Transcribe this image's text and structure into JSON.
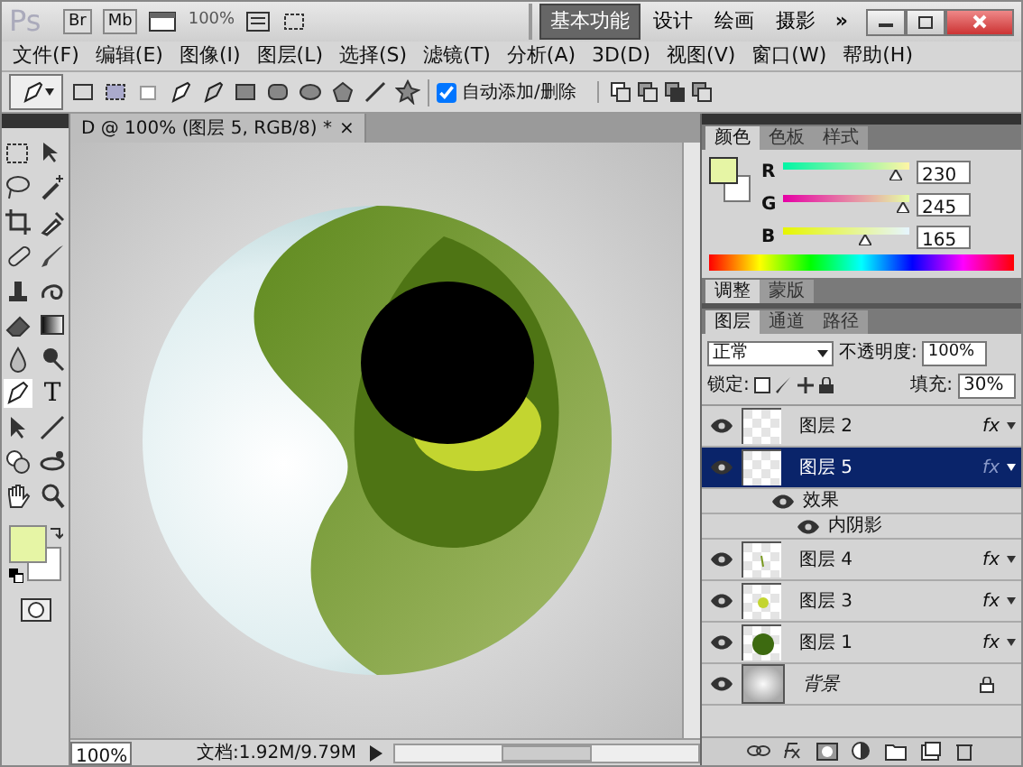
{
  "app_bar": {
    "logo": "Ps",
    "buttons": [
      "Br",
      "Mb"
    ],
    "zoom": "100%",
    "workspaces": [
      {
        "label": "基本功能",
        "selected": true
      },
      {
        "label": "设计",
        "selected": false
      },
      {
        "label": "绘画",
        "selected": false
      },
      {
        "label": "摄影",
        "selected": false
      }
    ],
    "more": "»"
  },
  "menu": [
    "文件(F)",
    "编辑(E)",
    "图像(I)",
    "图层(L)",
    "选择(S)",
    "滤镜(T)",
    "分析(A)",
    "3D(D)",
    "视图(V)",
    "窗口(W)",
    "帮助(H)"
  ],
  "options_bar": {
    "auto_add_delete": {
      "label": "自动添加/删除",
      "checked": true
    }
  },
  "toolbox": {
    "type_tool": "T"
  },
  "document": {
    "tab_title": "D @ 100% (图层 5, RGB/8) *",
    "close": "×",
    "zoom": "100%",
    "doc_info": "文档:1.92M/9.79M"
  },
  "color_panel": {
    "tabs": [
      {
        "label": "颜色",
        "selected": true
      },
      {
        "label": "色板",
        "selected": false
      },
      {
        "label": "样式",
        "selected": false
      }
    ],
    "channels": [
      {
        "name": "R",
        "level": 0.9,
        "value": "230"
      },
      {
        "name": "G",
        "level": 0.96,
        "value": "245"
      },
      {
        "name": "B",
        "level": 0.65,
        "value": "165"
      }
    ]
  },
  "adjust_panel": {
    "tabs": [
      {
        "label": "调整",
        "selected": true
      },
      {
        "label": "蒙版",
        "selected": false
      }
    ]
  },
  "layers_panel": {
    "tabs": [
      {
        "label": "图层",
        "selected": true
      },
      {
        "label": "通道",
        "selected": false
      },
      {
        "label": "路径",
        "selected": false
      }
    ],
    "blend_mode": "正常",
    "opacity_label": "不透明度:",
    "opacity": "100%",
    "lock_label": "锁定:",
    "fill_label": "填充:",
    "fill": "30%",
    "layers": [
      {
        "name": "图层 2",
        "kind": "plain",
        "visible": true,
        "selected": false,
        "fx": "fx"
      },
      {
        "name": "图层 5",
        "kind": "plain",
        "visible": true,
        "selected": true,
        "fx": "fx",
        "effects": [
          {
            "name": "效果",
            "visible": true,
            "children": [
              {
                "name": "内阴影",
                "visible": true
              }
            ]
          }
        ]
      },
      {
        "name": "图层 4",
        "kind": "stroke",
        "visible": true,
        "selected": false,
        "fx": "fx"
      },
      {
        "name": "图层 3",
        "kind": "dot",
        "visible": true,
        "selected": false,
        "fx": "fx"
      },
      {
        "name": "图层 1",
        "kind": "disc",
        "visible": true,
        "selected": false,
        "fx": "fx"
      },
      {
        "name": "背景",
        "kind": "background",
        "visible": true,
        "selected": false,
        "locked": true
      }
    ]
  }
}
